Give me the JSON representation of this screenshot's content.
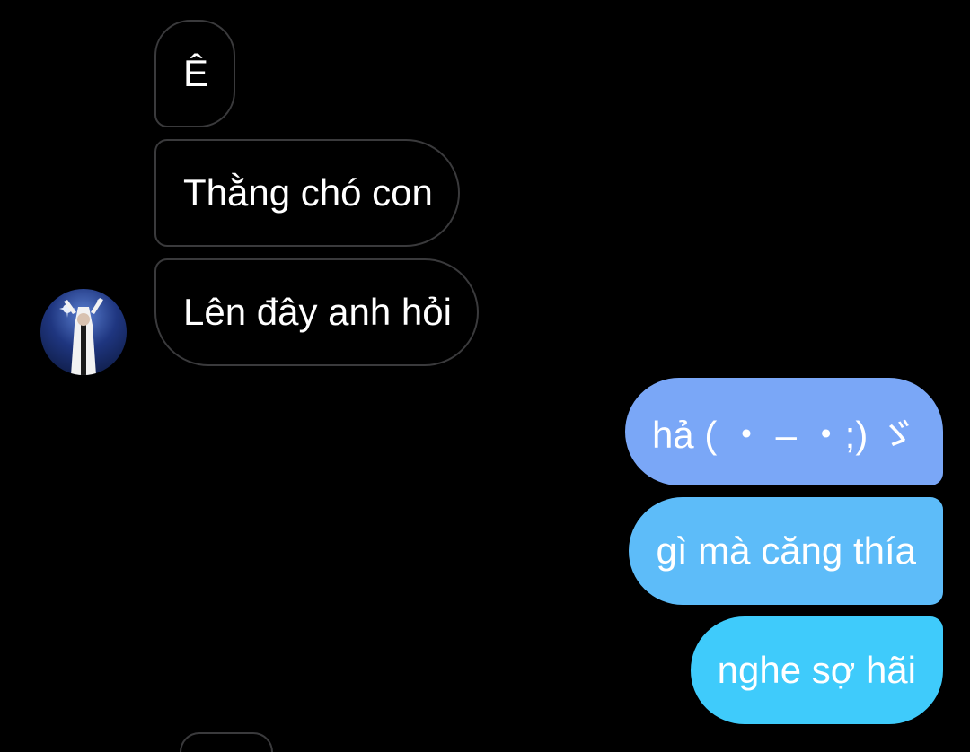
{
  "conversation": {
    "incoming": [
      {
        "text": "Ê"
      },
      {
        "text": "Thằng chó con"
      },
      {
        "text": "Lên đây anh hỏi"
      }
    ],
    "outgoing": [
      {
        "text": "hả ( ・ – ・;) ゞ"
      },
      {
        "text": "gì mà căng thía"
      },
      {
        "text": "nghe sợ hãi"
      }
    ]
  },
  "colors": {
    "background": "#000000",
    "incoming_border": "#3a3a3c",
    "outgoing_gradient": [
      "#7aa7f7",
      "#5dbcf9",
      "#3fcbfb"
    ]
  }
}
